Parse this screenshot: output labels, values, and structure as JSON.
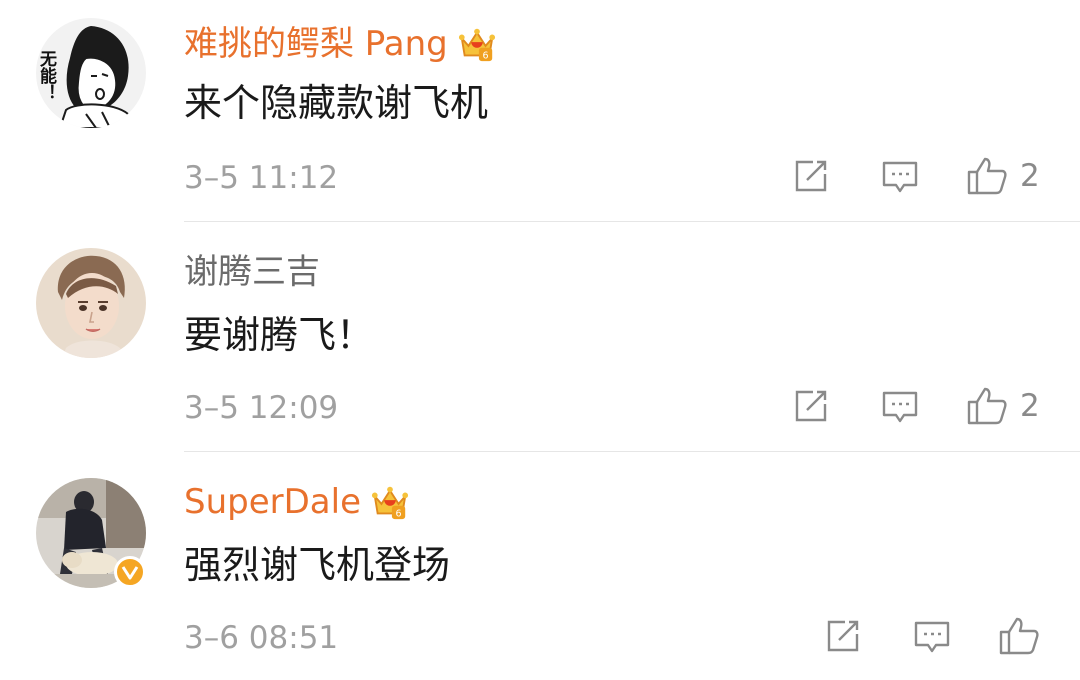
{
  "comments": [
    {
      "username": "难挑的鳄梨 Pang",
      "vip": true,
      "content": "来个隐藏款谢飞机",
      "timestamp": "3–5 11:12",
      "like_count": "2",
      "avatar_text": "无能！"
    },
    {
      "username": "谢腾三吉",
      "vip": false,
      "content": "要谢腾飞！",
      "timestamp": "3–5 12:09",
      "like_count": "2"
    },
    {
      "username": "SuperDale",
      "vip": true,
      "verified": true,
      "content": "强烈谢飞机登场",
      "timestamp": "3–6 08:51",
      "like_count": ""
    }
  ],
  "icons": {
    "share": "share-icon",
    "reply": "comment-icon",
    "like": "thumbs-up-icon",
    "vip_crown": "vip-crown-icon",
    "verified": "verified-badge-icon"
  },
  "colors": {
    "vip_name": "#e8712d",
    "normal_name": "#6b6b6b",
    "content": "#1a1a1a",
    "meta": "#a0a0a0",
    "verified_badge": "#f5a623"
  }
}
